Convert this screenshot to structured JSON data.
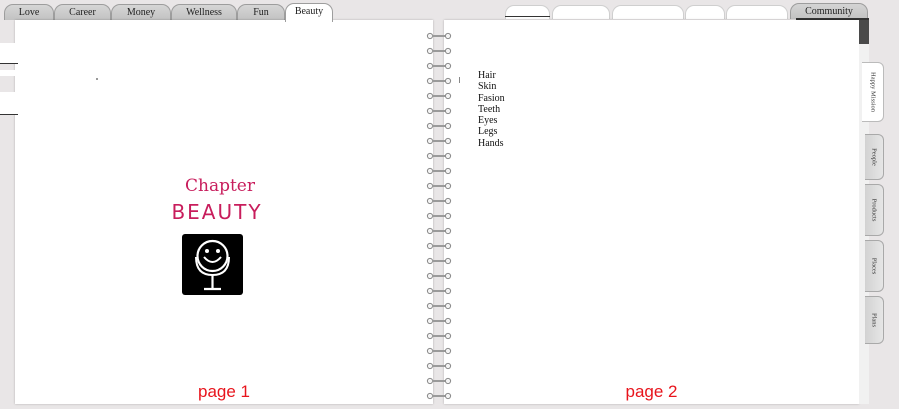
{
  "top_tabs": [
    {
      "label": "Love"
    },
    {
      "label": "Career"
    },
    {
      "label": "Money"
    },
    {
      "label": "Wellness"
    },
    {
      "label": "Fun"
    },
    {
      "label": "Beauty",
      "active": true
    }
  ],
  "community_tab": {
    "label": "Community"
  },
  "chapter": {
    "title": "Chapter",
    "subtitle": "BEAUTY",
    "icon": "smiling-mirror-icon"
  },
  "left_page": {
    "label": "page 1"
  },
  "right_page": {
    "label": "page 2",
    "topics": [
      "Hair",
      "Skin",
      "Fasion",
      "Teeth",
      "Eyes",
      "Legs",
      "Hands"
    ]
  },
  "side_tabs": [
    {
      "label": "Happy Mission",
      "active": true
    },
    {
      "label": "People"
    },
    {
      "label": "Products"
    },
    {
      "label": "Places"
    },
    {
      "label": "Plans"
    }
  ],
  "colors": {
    "chapter_accent": "#c81d5c",
    "page_label": "#e8141c",
    "background": "#e9e6e7"
  }
}
